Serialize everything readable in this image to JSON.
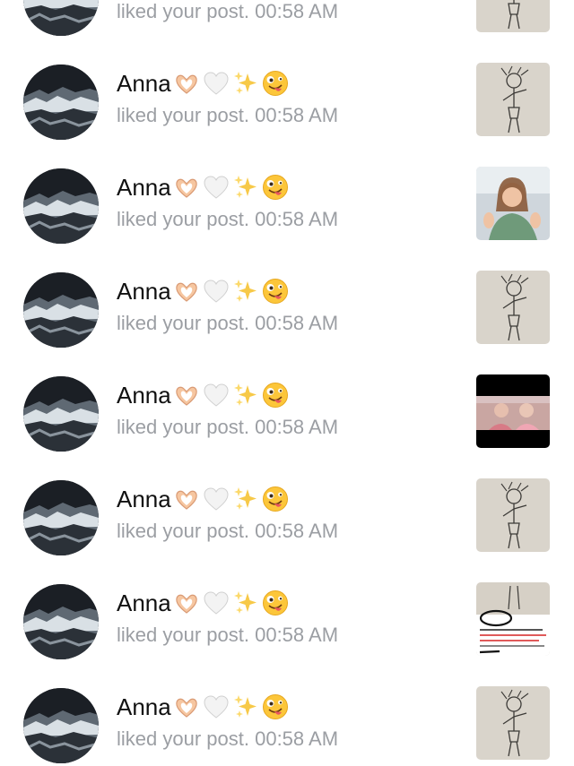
{
  "notifications": [
    {
      "name": "",
      "emojis": [],
      "action": "liked your post.",
      "time": "00:58 AM",
      "thumbnail": "sketch-post-thumbnail"
    },
    {
      "name": "Anna",
      "emojis": [
        "hand-heart-icon",
        "white-heart-icon",
        "sparkles-icon",
        "zany-face-icon"
      ],
      "action": "liked your post.",
      "time": "00:58 AM",
      "thumbnail": "sketch-post-thumbnail"
    },
    {
      "name": "Anna",
      "emojis": [
        "hand-heart-icon",
        "white-heart-icon",
        "sparkles-icon",
        "zany-face-icon"
      ],
      "action": "liked your post.",
      "time": "00:58 AM",
      "thumbnail": "photo-post-thumbnail"
    },
    {
      "name": "Anna",
      "emojis": [
        "hand-heart-icon",
        "white-heart-icon",
        "sparkles-icon",
        "zany-face-icon"
      ],
      "action": "liked your post.",
      "time": "00:58 AM",
      "thumbnail": "sketch-post-thumbnail"
    },
    {
      "name": "Anna",
      "emojis": [
        "hand-heart-icon",
        "white-heart-icon",
        "sparkles-icon",
        "zany-face-icon"
      ],
      "action": "liked your post.",
      "time": "00:58 AM",
      "thumbnail": "video-post-thumbnail"
    },
    {
      "name": "Anna",
      "emojis": [
        "hand-heart-icon",
        "white-heart-icon",
        "sparkles-icon",
        "zany-face-icon"
      ],
      "action": "liked your post.",
      "time": "00:58 AM",
      "thumbnail": "sketch-post-thumbnail"
    },
    {
      "name": "Anna",
      "emojis": [
        "hand-heart-icon",
        "white-heart-icon",
        "sparkles-icon",
        "zany-face-icon"
      ],
      "action": "liked your post.",
      "time": "00:58 AM",
      "thumbnail": "screenshot-post-thumbnail"
    },
    {
      "name": "Anna",
      "emojis": [
        "hand-heart-icon",
        "white-heart-icon",
        "sparkles-icon",
        "zany-face-icon"
      ],
      "action": "liked your post.",
      "time": "00:58 AM",
      "thumbnail": "sketch-post-thumbnail"
    }
  ]
}
